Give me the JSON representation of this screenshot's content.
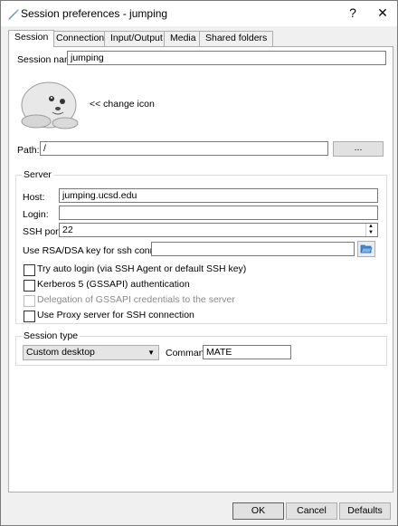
{
  "window": {
    "title": "Session preferences - jumping",
    "help_label": "?",
    "close_label": "✕"
  },
  "tabs": [
    {
      "label": "Session"
    },
    {
      "label": "Connection"
    },
    {
      "label": "Input/Output"
    },
    {
      "label": "Media"
    },
    {
      "label": "Shared folders"
    }
  ],
  "session": {
    "name_label": "Session name:",
    "name_value": "jumping",
    "change_icon_label": "<< change icon",
    "path_label": "Path:",
    "path_value": "/",
    "browse_label": "..."
  },
  "server": {
    "group_title": "Server",
    "host_label": "Host:",
    "host_value": "jumping.ucsd.edu",
    "login_label": "Login:",
    "login_value": "",
    "ssh_port_label": "SSH port:",
    "ssh_port_value": "22",
    "rsa_label": "Use RSA/DSA key for ssh connection:",
    "rsa_value": "",
    "auto_login_label": "Try auto login (via SSH Agent or default SSH key)",
    "kerberos_label": "Kerberos 5 (GSSAPI) authentication",
    "delegation_label": "Delegation of GSSAPI credentials to the server",
    "proxy_label": "Use Proxy server for SSH connection"
  },
  "session_type": {
    "group_title": "Session type",
    "selected": "Custom desktop",
    "command_label": "Command:",
    "command_value": "MATE"
  },
  "footer": {
    "ok_label": "OK",
    "cancel_label": "Cancel",
    "defaults_label": "Defaults"
  }
}
